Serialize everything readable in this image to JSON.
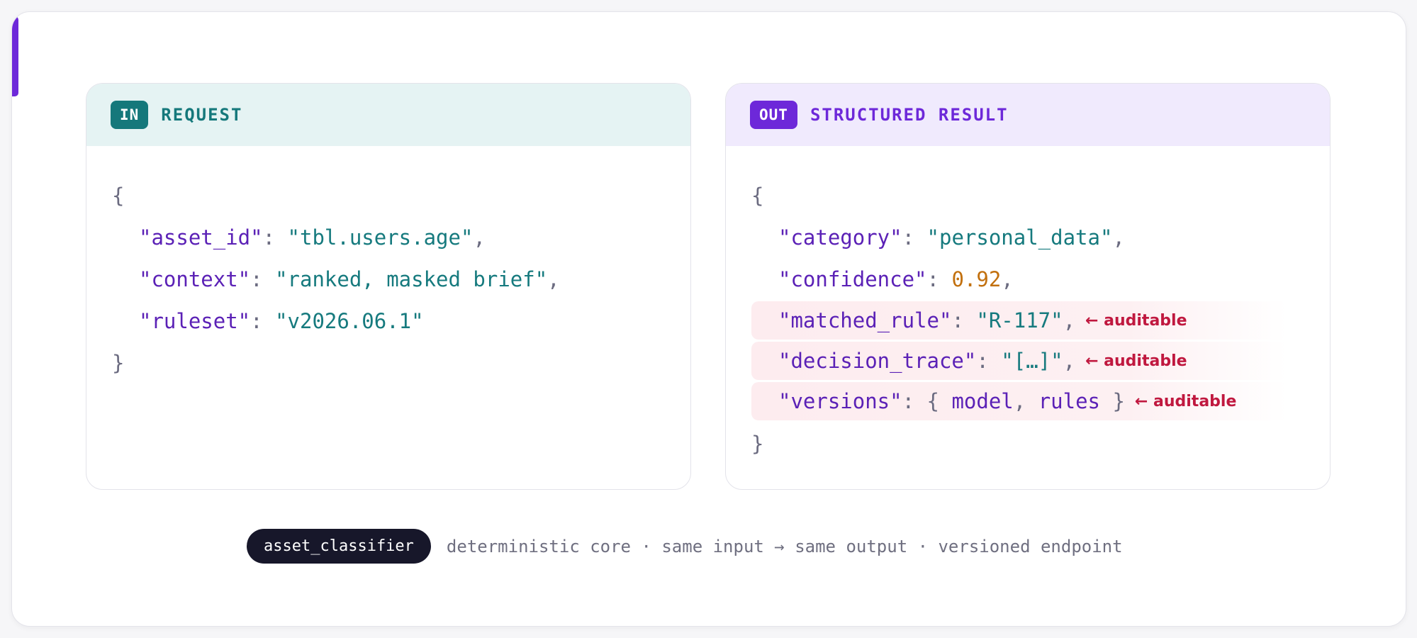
{
  "request": {
    "badge": "IN",
    "title": "REQUEST",
    "open_brace": "{",
    "close_brace": "}",
    "lines": [
      {
        "key": "\"asset_id\"",
        "sep": ": ",
        "value": "\"tbl.users.age\"",
        "tail": ","
      },
      {
        "key": "\"context\"",
        "sep": ": ",
        "value": "\"ranked, masked brief\"",
        "tail": ","
      },
      {
        "key": "\"ruleset\"",
        "sep": ": ",
        "value": "\"v2026.06.1\"",
        "tail": ""
      }
    ]
  },
  "result": {
    "badge": "OUT",
    "title": "STRUCTURED RESULT",
    "open_brace": "{",
    "close_brace": "}",
    "lines": [
      {
        "key": "\"category\"",
        "sep": ": ",
        "value": "\"personal_data\"",
        "tail": ","
      },
      {
        "key": "\"confidence\"",
        "sep": ": ",
        "value": "0.92",
        "tail": ","
      },
      {
        "key": "\"matched_rule\"",
        "sep": ": ",
        "value": "\"R-117\"",
        "tail": ",",
        "note": "← auditable"
      },
      {
        "key": "\"decision_trace\"",
        "sep": ": ",
        "value": "\"[…]\"",
        "tail": ",",
        "note": "← auditable"
      },
      {
        "key": "\"versions\"",
        "sep": ": ",
        "obj_open": "{ ",
        "obj_body_a": "model",
        "obj_comma": ", ",
        "obj_body_b": "rules",
        "obj_close": " }",
        "note": "← auditable"
      }
    ]
  },
  "footer": {
    "pill": "asset_classifier",
    "text": "deterministic core · same input → same output · versioned endpoint"
  },
  "colors": {
    "teal": "#15787b",
    "purple": "#6d28d9",
    "auditable": "#c0183f",
    "number": "#c2700e"
  }
}
